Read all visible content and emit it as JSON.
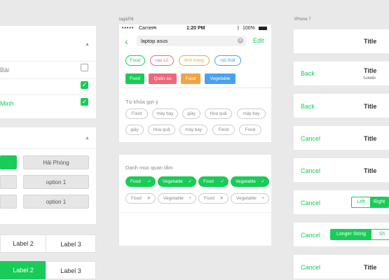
{
  "labels": {
    "middle_caption": "tag&Pill",
    "right_caption": "iPhone 7"
  },
  "colors": {
    "accent": "#18cc57",
    "page_bg": "#e9e9ea"
  },
  "left": {
    "checkbox_rows": [
      {
        "label": "Bái",
        "checked": false
      },
      {
        "label": "",
        "checked": true
      },
      {
        "label": "Minh",
        "checked": true
      }
    ],
    "buttons": [
      {
        "label": "",
        "active": true
      },
      {
        "label": "Hải Phòng",
        "active": false
      },
      {
        "label": "",
        "active": false
      },
      {
        "label": "option 1",
        "active": false
      },
      {
        "label": "",
        "active": false
      },
      {
        "label": "option 1",
        "active": false
      }
    ],
    "segment_row1": [
      "",
      "Label 2",
      "Label 3"
    ],
    "segment_row2": [
      "Label 2",
      "Label 3"
    ]
  },
  "phone": {
    "status": {
      "carrier": "Carrier",
      "time": "1:20 PM",
      "battery": "100%"
    },
    "search": {
      "value": "laptop asus",
      "action": "Edit"
    },
    "tags": [
      {
        "label": "Food",
        "color": "#18cc57"
      },
      {
        "label": "rau củ",
        "color": "#f0667a"
      },
      {
        "label": "thời trang",
        "color": "#f0a442"
      },
      {
        "label": "nội thất",
        "color": "#4aa0f0"
      }
    ],
    "filled_tags": [
      {
        "label": "Food",
        "color": "#18cc57"
      },
      {
        "label": "Quần áo",
        "color": "#f0667a"
      },
      {
        "label": "Food",
        "color": "#f0a442"
      },
      {
        "label": "Vegetable",
        "color": "#4aa0f0"
      }
    ],
    "suggest_title": "Từ khóa gợi ý",
    "suggest_row1": [
      "Food",
      "máy bay",
      "giày",
      "Hoa quả",
      "máy bay"
    ],
    "suggest_row2": [
      "giày",
      "Hoa quả",
      "máy bay",
      "Food",
      "Food"
    ],
    "interest_title": "Danh mục quan tâm",
    "interest_row1": [
      {
        "label": "Food",
        "icon": "✓"
      },
      {
        "label": "Vegetable",
        "icon": "✓"
      },
      {
        "label": "Food",
        "icon": "✓"
      },
      {
        "label": "Vegetable",
        "icon": "✓"
      }
    ],
    "interest_row2": [
      {
        "label": "Food",
        "icon": "✕"
      },
      {
        "label": "Vegetable",
        "icon": "+"
      },
      {
        "label": "Food",
        "icon": "✕"
      },
      {
        "label": "Vegetable",
        "icon": "+"
      }
    ]
  },
  "navbars": [
    {
      "left": "",
      "title": "Title"
    },
    {
      "left": "Back",
      "title": "Title",
      "subtitle": "Subtitle"
    },
    {
      "left": "Back",
      "title": "Title"
    },
    {
      "left": "Cancel",
      "title": "Title"
    },
    {
      "left": "Cancel",
      "title": "Title"
    },
    {
      "left": "Cancel",
      "segments": [
        "Left",
        "Right"
      ]
    },
    {
      "left": "Cancel",
      "segments": [
        "Longer String",
        "Sh"
      ]
    },
    {
      "left": "Cancel",
      "title": "Title"
    }
  ]
}
